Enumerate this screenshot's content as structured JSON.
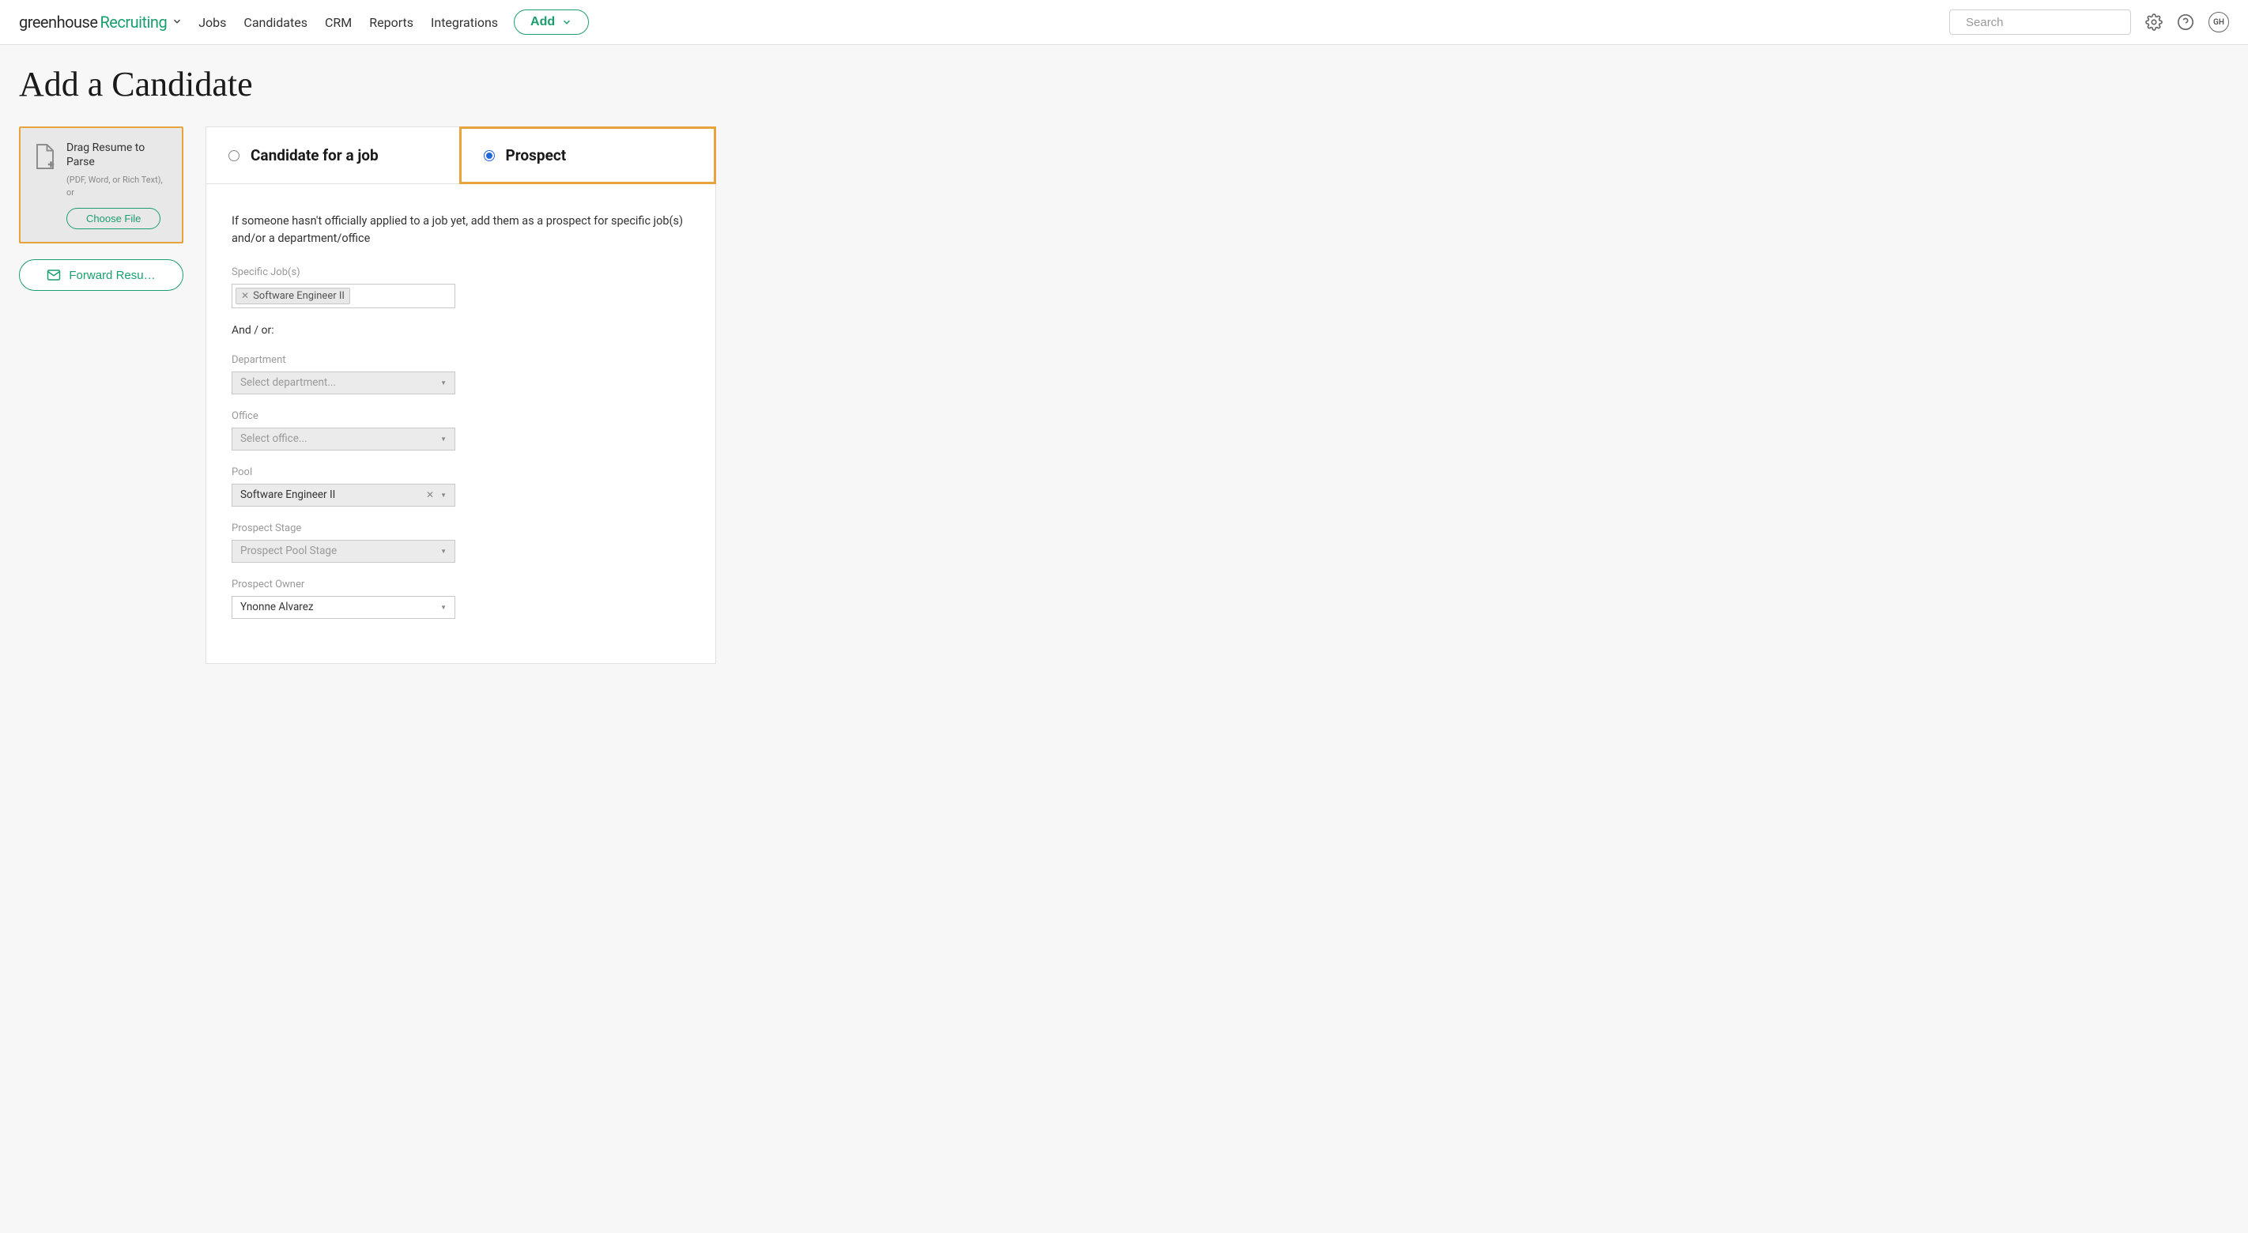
{
  "nav": {
    "logo": {
      "greenhouse": "greenhouse",
      "recruiting": "Recruiting"
    },
    "links": [
      "Jobs",
      "Candidates",
      "CRM",
      "Reports",
      "Integrations"
    ],
    "add_label": "Add",
    "search_placeholder": "Search",
    "avatar_initials": "GH"
  },
  "page": {
    "title": "Add a Candidate"
  },
  "sidebar": {
    "dropzone": {
      "title": "Drag Resume to Parse",
      "hint": "(PDF, Word, or Rich Text), or",
      "choose_file": "Choose File"
    },
    "forward_label": "Forward Resu…"
  },
  "tabs": {
    "candidate": "Candidate for a job",
    "prospect": "Prospect"
  },
  "form": {
    "intro": "If someone hasn't officially applied to a job yet, add them as a prospect for specific job(s) and/or a department/office",
    "specific_jobs": {
      "label": "Specific Job(s)",
      "tag": "Software Engineer II"
    },
    "andor": "And / or:",
    "department": {
      "label": "Department",
      "placeholder": "Select department..."
    },
    "office": {
      "label": "Office",
      "placeholder": "Select office..."
    },
    "pool": {
      "label": "Pool",
      "value": "Software Engineer II"
    },
    "prospect_stage": {
      "label": "Prospect Stage",
      "placeholder": "Prospect Pool Stage"
    },
    "prospect_owner": {
      "label": "Prospect Owner",
      "value": "Ynonne Alvarez"
    }
  }
}
